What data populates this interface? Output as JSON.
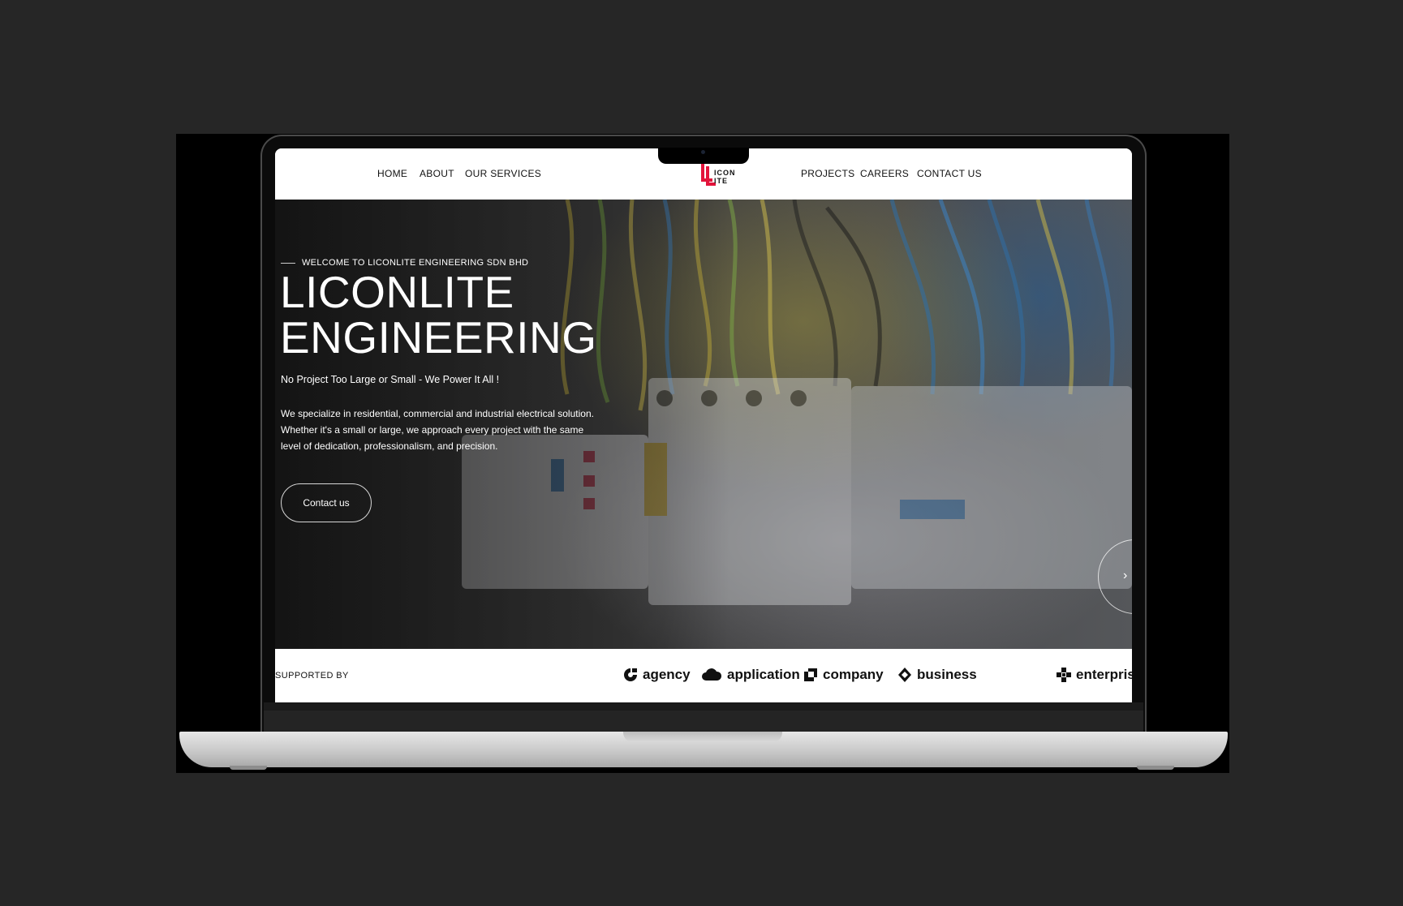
{
  "nav": {
    "left": [
      "HOME",
      "ABOUT",
      "OUR SERVICES"
    ],
    "right": [
      "PROJECTS",
      "CAREERS",
      "CONTACT US"
    ],
    "logo": {
      "line1": "ICON",
      "line2": "ITE",
      "brand_color": "#e3143b"
    }
  },
  "hero": {
    "eyebrow": "WELCOME TO LICONLITE ENGINEERING SDN BHD",
    "title_line1": "LICONLITE",
    "title_line2": "ENGINEERING",
    "tagline": "No Project Too Large or Small - We Power It All !",
    "description": "We specialize in residential, commercial and industrial electrical solution. Whether it's a small or large, we approach every project with the same level of dedication, professionalism, and precision.",
    "cta": "Contact us",
    "next_icon": "chevron-right-icon"
  },
  "supported": {
    "label": "SUPPORTED BY",
    "sponsors": [
      {
        "name": "agency",
        "icon": "agency-logo-icon"
      },
      {
        "name": "application",
        "icon": "cloud-logo-icon"
      },
      {
        "name": "company",
        "icon": "squares-logo-icon"
      },
      {
        "name": "business",
        "icon": "diamond-logo-icon"
      },
      {
        "name": "enterpris",
        "icon": "cross-logo-icon"
      }
    ]
  }
}
